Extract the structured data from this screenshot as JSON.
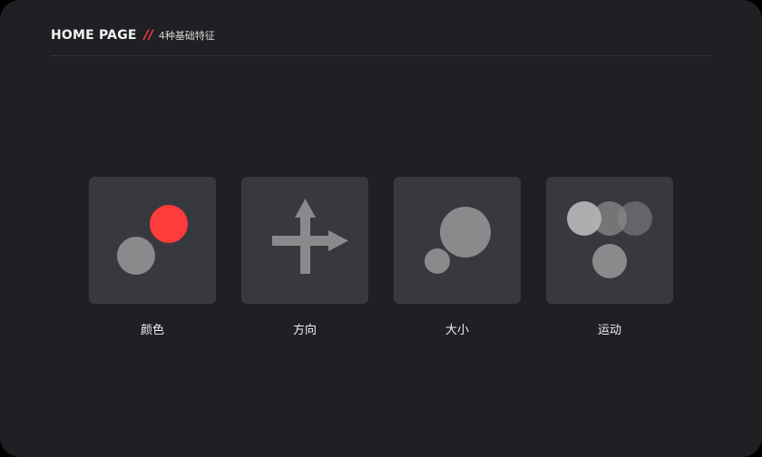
{
  "header": {
    "title": "HOME PAGE",
    "separator": "//",
    "subtitle": "4种基础特征"
  },
  "colors": {
    "background": "#1f2024",
    "tile": "#38393e",
    "accent": "#ff3b3b",
    "shape_gray": "#8a8a8c"
  },
  "cards": [
    {
      "label": "颜色",
      "icon": "color-circles-icon"
    },
    {
      "label": "方向",
      "icon": "direction-arrows-icon"
    },
    {
      "label": "大小",
      "icon": "size-circles-icon"
    },
    {
      "label": "运动",
      "icon": "motion-circles-icon"
    }
  ]
}
